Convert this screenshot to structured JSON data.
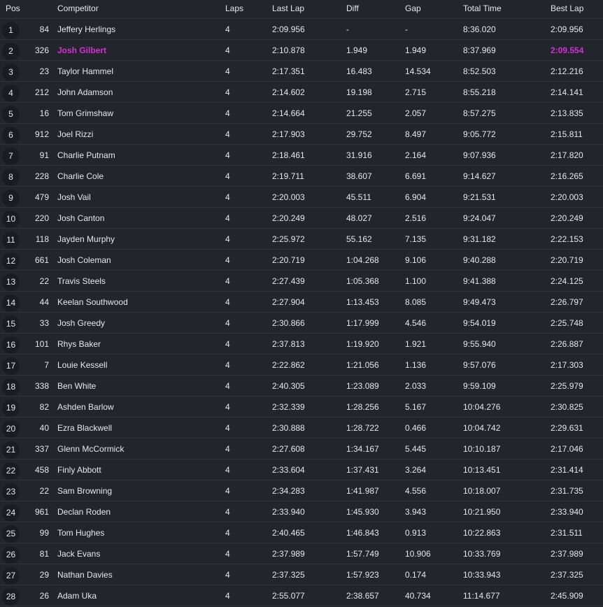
{
  "columns": {
    "pos": "Pos",
    "competitor": "Competitor",
    "laps": "Laps",
    "last_lap": "Last Lap",
    "diff": "Diff",
    "gap": "Gap",
    "total_time": "Total Time",
    "best_lap": "Best Lap"
  },
  "highlight_color": "#d62fd6",
  "rows": [
    {
      "pos": "1",
      "number": "84",
      "name": "Jeffery Herlings",
      "laps": "4",
      "last_lap": "2:09.956",
      "diff": "-",
      "gap": "-",
      "total_time": "8:36.020",
      "best_lap": "2:09.956"
    },
    {
      "pos": "2",
      "number": "326",
      "name": "Josh Gilbert",
      "laps": "4",
      "last_lap": "2:10.878",
      "diff": "1.949",
      "gap": "1.949",
      "total_time": "8:37.969",
      "best_lap": "2:09.554",
      "highlight": true
    },
    {
      "pos": "3",
      "number": "23",
      "name": "Taylor Hammel",
      "laps": "4",
      "last_lap": "2:17.351",
      "diff": "16.483",
      "gap": "14.534",
      "total_time": "8:52.503",
      "best_lap": "2:12.216"
    },
    {
      "pos": "4",
      "number": "212",
      "name": "John Adamson",
      "laps": "4",
      "last_lap": "2:14.602",
      "diff": "19.198",
      "gap": "2.715",
      "total_time": "8:55.218",
      "best_lap": "2:14.141"
    },
    {
      "pos": "5",
      "number": "16",
      "name": "Tom Grimshaw",
      "laps": "4",
      "last_lap": "2:14.664",
      "diff": "21.255",
      "gap": "2.057",
      "total_time": "8:57.275",
      "best_lap": "2:13.835"
    },
    {
      "pos": "6",
      "number": "912",
      "name": "Joel Rizzi",
      "laps": "4",
      "last_lap": "2:17.903",
      "diff": "29.752",
      "gap": "8.497",
      "total_time": "9:05.772",
      "best_lap": "2:15.811"
    },
    {
      "pos": "7",
      "number": "91",
      "name": "Charlie Putnam",
      "laps": "4",
      "last_lap": "2:18.461",
      "diff": "31.916",
      "gap": "2.164",
      "total_time": "9:07.936",
      "best_lap": "2:17.820"
    },
    {
      "pos": "8",
      "number": "228",
      "name": "Charlie Cole",
      "laps": "4",
      "last_lap": "2:19.711",
      "diff": "38.607",
      "gap": "6.691",
      "total_time": "9:14.627",
      "best_lap": "2:16.265"
    },
    {
      "pos": "9",
      "number": "479",
      "name": "Josh Vail",
      "laps": "4",
      "last_lap": "2:20.003",
      "diff": "45.511",
      "gap": "6.904",
      "total_time": "9:21.531",
      "best_lap": "2:20.003"
    },
    {
      "pos": "10",
      "number": "220",
      "name": "Josh Canton",
      "laps": "4",
      "last_lap": "2:20.249",
      "diff": "48.027",
      "gap": "2.516",
      "total_time": "9:24.047",
      "best_lap": "2:20.249"
    },
    {
      "pos": "11",
      "number": "118",
      "name": "Jayden Murphy",
      "laps": "4",
      "last_lap": "2:25.972",
      "diff": "55.162",
      "gap": "7.135",
      "total_time": "9:31.182",
      "best_lap": "2:22.153"
    },
    {
      "pos": "12",
      "number": "661",
      "name": "Josh Coleman",
      "laps": "4",
      "last_lap": "2:20.719",
      "diff": "1:04.268",
      "gap": "9.106",
      "total_time": "9:40.288",
      "best_lap": "2:20.719"
    },
    {
      "pos": "13",
      "number": "22",
      "name": "Travis Steels",
      "laps": "4",
      "last_lap": "2:27.439",
      "diff": "1:05.368",
      "gap": "1.100",
      "total_time": "9:41.388",
      "best_lap": "2:24.125"
    },
    {
      "pos": "14",
      "number": "44",
      "name": "Keelan Southwood",
      "laps": "4",
      "last_lap": "2:27.904",
      "diff": "1:13.453",
      "gap": "8.085",
      "total_time": "9:49.473",
      "best_lap": "2:26.797"
    },
    {
      "pos": "15",
      "number": "33",
      "name": "Josh Greedy",
      "laps": "4",
      "last_lap": "2:30.866",
      "diff": "1:17.999",
      "gap": "4.546",
      "total_time": "9:54.019",
      "best_lap": "2:25.748"
    },
    {
      "pos": "16",
      "number": "101",
      "name": "Rhys Baker",
      "laps": "4",
      "last_lap": "2:37.813",
      "diff": "1:19.920",
      "gap": "1.921",
      "total_time": "9:55.940",
      "best_lap": "2:26.887"
    },
    {
      "pos": "17",
      "number": "7",
      "name": "Louie Kessell",
      "laps": "4",
      "last_lap": "2:22.862",
      "diff": "1:21.056",
      "gap": "1.136",
      "total_time": "9:57.076",
      "best_lap": "2:17.303"
    },
    {
      "pos": "18",
      "number": "338",
      "name": "Ben White",
      "laps": "4",
      "last_lap": "2:40.305",
      "diff": "1:23.089",
      "gap": "2.033",
      "total_time": "9:59.109",
      "best_lap": "2:25.979"
    },
    {
      "pos": "19",
      "number": "82",
      "name": "Ashden Barlow",
      "laps": "4",
      "last_lap": "2:32.339",
      "diff": "1:28.256",
      "gap": "5.167",
      "total_time": "10:04.276",
      "best_lap": "2:30.825"
    },
    {
      "pos": "20",
      "number": "40",
      "name": "Ezra Blackwell",
      "laps": "4",
      "last_lap": "2:30.888",
      "diff": "1:28.722",
      "gap": "0.466",
      "total_time": "10:04.742",
      "best_lap": "2:29.631"
    },
    {
      "pos": "21",
      "number": "337",
      "name": "Glenn McCormick",
      "laps": "4",
      "last_lap": "2:27.608",
      "diff": "1:34.167",
      "gap": "5.445",
      "total_time": "10:10.187",
      "best_lap": "2:17.046"
    },
    {
      "pos": "22",
      "number": "458",
      "name": "Finly Abbott",
      "laps": "4",
      "last_lap": "2:33.604",
      "diff": "1:37.431",
      "gap": "3.264",
      "total_time": "10:13.451",
      "best_lap": "2:31.414"
    },
    {
      "pos": "23",
      "number": "22",
      "name": "Sam Browning",
      "laps": "4",
      "last_lap": "2:34.283",
      "diff": "1:41.987",
      "gap": "4.556",
      "total_time": "10:18.007",
      "best_lap": "2:31.735"
    },
    {
      "pos": "24",
      "number": "961",
      "name": "Declan Roden",
      "laps": "4",
      "last_lap": "2:33.940",
      "diff": "1:45.930",
      "gap": "3.943",
      "total_time": "10:21.950",
      "best_lap": "2:33.940"
    },
    {
      "pos": "25",
      "number": "99",
      "name": "Tom Hughes",
      "laps": "4",
      "last_lap": "2:40.465",
      "diff": "1:46.843",
      "gap": "0.913",
      "total_time": "10:22.863",
      "best_lap": "2:31.511"
    },
    {
      "pos": "26",
      "number": "81",
      "name": "Jack Evans",
      "laps": "4",
      "last_lap": "2:37.989",
      "diff": "1:57.749",
      "gap": "10.906",
      "total_time": "10:33.769",
      "best_lap": "2:37.989"
    },
    {
      "pos": "27",
      "number": "29",
      "name": "Nathan Davies",
      "laps": "4",
      "last_lap": "2:37.325",
      "diff": "1:57.923",
      "gap": "0.174",
      "total_time": "10:33.943",
      "best_lap": "2:37.325"
    },
    {
      "pos": "28",
      "number": "26",
      "name": "Adam Uka",
      "laps": "4",
      "last_lap": "2:55.077",
      "diff": "2:38.657",
      "gap": "40.734",
      "total_time": "11:14.677",
      "best_lap": "2:45.909"
    }
  ]
}
